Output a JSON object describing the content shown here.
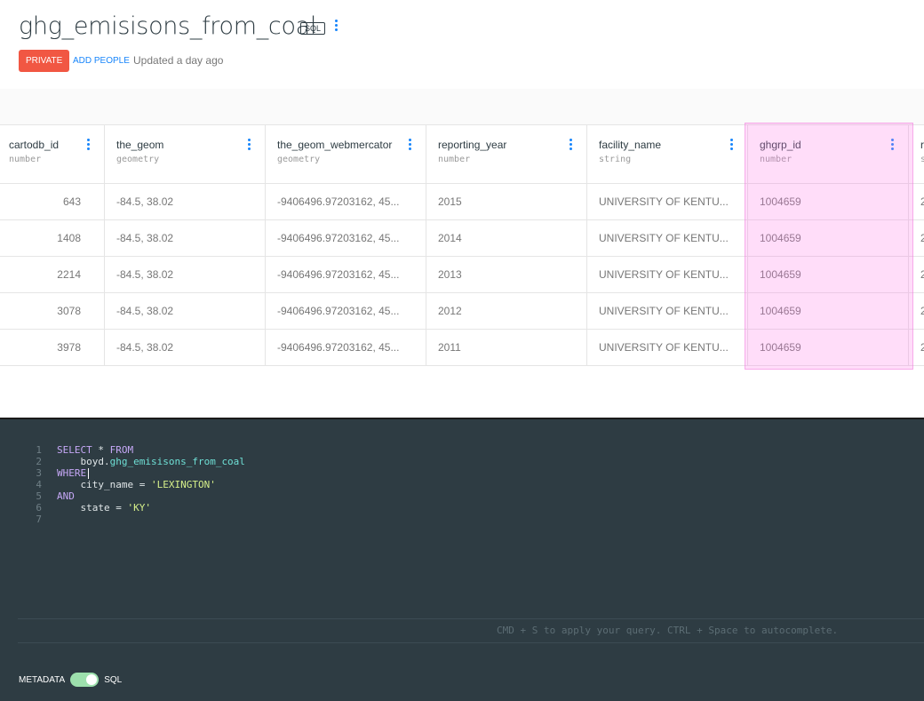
{
  "header": {
    "title": "ghg_emisisons_from_coal",
    "type_badge": "SQL",
    "privacy": "PRIVATE",
    "add_people": "ADD PEOPLE",
    "updated": "Updated a day ago"
  },
  "table": {
    "columns": [
      {
        "name": "cartodb_id",
        "type": "number"
      },
      {
        "name": "the_geom",
        "type": "geometry"
      },
      {
        "name": "the_geom_webmercator",
        "type": "geometry"
      },
      {
        "name": "reporting_year",
        "type": "number"
      },
      {
        "name": "facility_name",
        "type": "string"
      },
      {
        "name": "ghgrp_id",
        "type": "number"
      },
      {
        "name": "r",
        "type": "s"
      }
    ],
    "rows": [
      [
        "643",
        "-84.5, 38.02",
        "-9406496.97203162, 45...",
        "2015",
        "UNIVERSITY OF KENTU...",
        "1004659",
        "2"
      ],
      [
        "1408",
        "-84.5, 38.02",
        "-9406496.97203162, 45...",
        "2014",
        "UNIVERSITY OF KENTU...",
        "1004659",
        "2"
      ],
      [
        "2214",
        "-84.5, 38.02",
        "-9406496.97203162, 45...",
        "2013",
        "UNIVERSITY OF KENTU...",
        "1004659",
        "2"
      ],
      [
        "3078",
        "-84.5, 38.02",
        "-9406496.97203162, 45...",
        "2012",
        "UNIVERSITY OF KENTU...",
        "1004659",
        "2"
      ],
      [
        "3978",
        "-84.5, 38.02",
        "-9406496.97203162, 45...",
        "2011",
        "UNIVERSITY OF KENTU...",
        "1004659",
        "2"
      ]
    ]
  },
  "editor": {
    "lines": [
      [
        {
          "t": "kw",
          "v": "SELECT"
        },
        {
          "t": "plain",
          "v": " * "
        },
        {
          "t": "kw",
          "v": "FROM"
        }
      ],
      [
        {
          "t": "plain",
          "v": "    boyd."
        },
        {
          "t": "tbl",
          "v": "ghg_emisisons_from_coal"
        }
      ],
      [
        {
          "t": "kw",
          "v": "WHERE"
        },
        {
          "t": "cursor",
          "v": ""
        }
      ],
      [
        {
          "t": "plain",
          "v": "    city_name = "
        },
        {
          "t": "str",
          "v": "'LEXINGTON'"
        }
      ],
      [
        {
          "t": "kw",
          "v": "AND"
        }
      ],
      [
        {
          "t": "plain",
          "v": "    state = "
        },
        {
          "t": "str",
          "v": "'KY'"
        }
      ],
      []
    ],
    "hint": "CMD + S to apply your query. CTRL + Space to autocomplete."
  },
  "footer": {
    "metadata_label": "METADATA",
    "sql_label": "SQL"
  },
  "colors": {
    "privacy_badge": "#f15743",
    "link": "#1785fb",
    "editor_bg": "#2e3c43",
    "toggle": "#9de0ad",
    "highlight": "#ff78e6"
  }
}
